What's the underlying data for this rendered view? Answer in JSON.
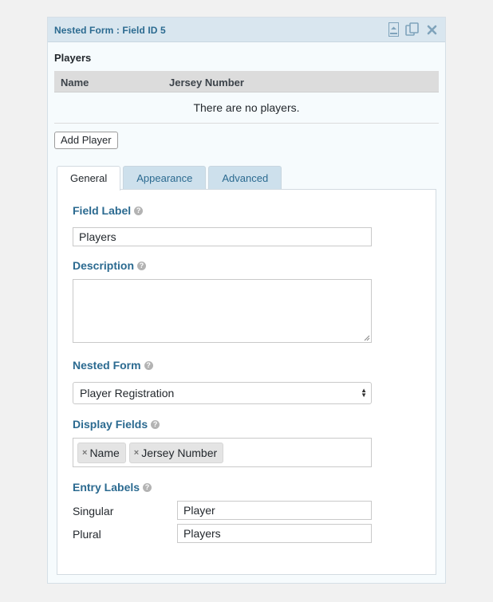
{
  "titlebar": {
    "title": "Nested Form : Field ID 5",
    "icons": [
      "collapse-icon",
      "duplicate-icon",
      "delete-icon"
    ]
  },
  "preview": {
    "label": "Players",
    "table": {
      "columns": [
        "Name",
        "Jersey Number"
      ],
      "empty_message": "There are no players."
    },
    "add_button": "Add Player"
  },
  "tabs": [
    {
      "label": "General",
      "active": true
    },
    {
      "label": "Appearance",
      "active": false
    },
    {
      "label": "Advanced",
      "active": false
    }
  ],
  "settings": {
    "field_label": {
      "label": "Field Label",
      "value": "Players"
    },
    "description": {
      "label": "Description",
      "value": ""
    },
    "nested_form": {
      "label": "Nested Form",
      "selected": "Player Registration"
    },
    "display_fields": {
      "label": "Display Fields",
      "chips": [
        "Name",
        "Jersey Number"
      ]
    },
    "entry_labels": {
      "label": "Entry Labels",
      "singular": {
        "label": "Singular",
        "value": "Player"
      },
      "plural": {
        "label": "Plural",
        "value": "Players"
      }
    }
  },
  "colors": {
    "accent": "#2b6a90",
    "titlebar_bg": "#d9e6ef",
    "inactive_tab_bg": "#cde0ec"
  }
}
